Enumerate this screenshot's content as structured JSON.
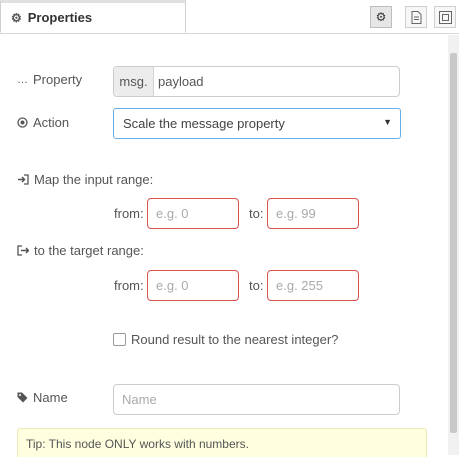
{
  "tab": {
    "title": "Properties",
    "icon": "gear-icon"
  },
  "toolbar": {
    "icons": [
      "gear-icon",
      "document-icon",
      "frame-icon"
    ]
  },
  "property": {
    "label": "Property",
    "prefix": "msg.",
    "value": "payload"
  },
  "action": {
    "label": "Action",
    "selected": "Scale the message property"
  },
  "input_range": {
    "label": "Map the input range:",
    "from_label": "from:",
    "from_placeholder": "e.g. 0",
    "to_label": "to:",
    "to_placeholder": "e.g. 99"
  },
  "target_range": {
    "label": "to the target range:",
    "from_label": "from:",
    "from_placeholder": "e.g. 0",
    "to_label": "to:",
    "to_placeholder": "e.g. 255"
  },
  "round": {
    "label": "Round result to the nearest integer?",
    "checked": false
  },
  "name": {
    "label": "Name",
    "placeholder": "Name"
  },
  "tip": {
    "text": "Tip: This node ONLY works with numbers."
  },
  "colors": {
    "error_border": "#d9534f",
    "focus_border": "#66afe9",
    "tip_background": "#ffffe0"
  }
}
